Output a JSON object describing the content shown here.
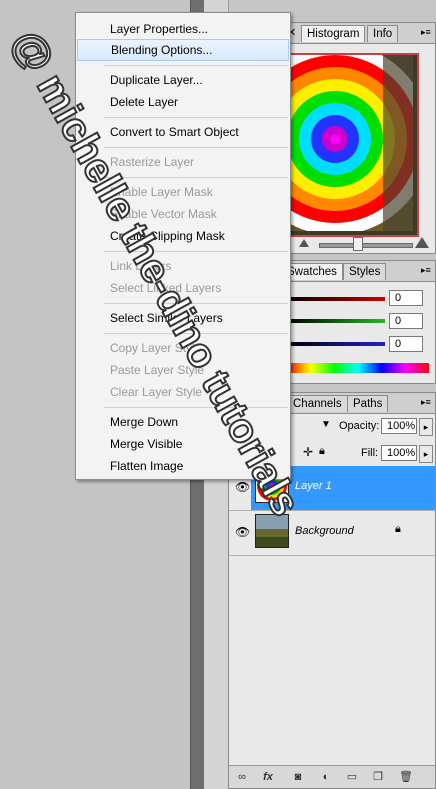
{
  "context_menu": {
    "items": [
      {
        "label": "Layer Properties...",
        "enabled": true
      },
      {
        "label": "Blending Options...",
        "enabled": true,
        "highlighted": true
      },
      {
        "label": "Duplicate Layer...",
        "enabled": true
      },
      {
        "label": "Delete Layer",
        "enabled": true
      },
      {
        "label": "Convert to Smart Object",
        "enabled": true
      },
      {
        "label": "Rasterize Layer",
        "enabled": false
      },
      {
        "label": "Enable Layer Mask",
        "enabled": false
      },
      {
        "label": "Enable Vector Mask",
        "enabled": false
      },
      {
        "label": "Create Clipping Mask",
        "enabled": true
      },
      {
        "label": "Link Layers",
        "enabled": false
      },
      {
        "label": "Select Linked Layers",
        "enabled": false
      },
      {
        "label": "Select Similar Layers",
        "enabled": true
      },
      {
        "label": "Copy Layer Style",
        "enabled": false
      },
      {
        "label": "Paste Layer Style",
        "enabled": false
      },
      {
        "label": "Clear Layer Style",
        "enabled": false
      },
      {
        "label": "Merge Down",
        "enabled": true
      },
      {
        "label": "Merge Visible",
        "enabled": true
      },
      {
        "label": "Flatten Image",
        "enabled": true
      }
    ]
  },
  "navigator_panel": {
    "tabs": [
      "Histogram",
      "Info"
    ]
  },
  "color_panel": {
    "tabs": [
      "Swatches",
      "Styles"
    ],
    "red": {
      "value": "0",
      "color": "#c00000"
    },
    "green": {
      "value": "0",
      "color": "#22aa22"
    },
    "blue": {
      "value": "0",
      "color": "#2020c0"
    }
  },
  "layers_panel": {
    "tabs": [
      "Channels",
      "Paths"
    ],
    "opacity_label": "Opacity:",
    "opacity_value": "100%",
    "fill_label": "Fill:",
    "fill_value": "100%",
    "layers": [
      {
        "name": "Layer 1",
        "selected": true
      },
      {
        "name": "Background",
        "selected": false,
        "locked": true
      }
    ],
    "footer_icons": [
      "link-icon",
      "fx-icon",
      "mask-icon",
      "adjustment-icon",
      "folder-icon",
      "new-layer-icon",
      "trash-icon"
    ]
  },
  "watermark": {
    "text": "@ michelle the-dino tutorials"
  },
  "colors": {
    "highlight_row": "#3399ff",
    "menu_bg": "#f3f3f3"
  }
}
